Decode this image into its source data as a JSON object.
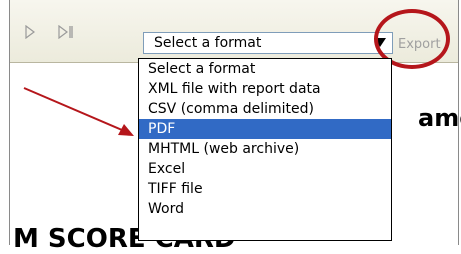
{
  "toolbar": {
    "play_icon": "play-icon",
    "step_icon": "play-to-end-icon",
    "format_select": {
      "value": "Select a format"
    },
    "export_label": "Export"
  },
  "dropdown": {
    "options": [
      "Select a format",
      "XML file with report data",
      "CSV (comma delimited)",
      "PDF",
      "MHTML (web archive)",
      "Excel",
      "TIFF file",
      "Word"
    ],
    "highlighted": "PDF"
  },
  "report": {
    "partial_text_right": "ame",
    "partial_text_bottom": "M SCORE CARD"
  },
  "colors": {
    "annotation": "#b5161b",
    "highlight": "#316ac5"
  }
}
